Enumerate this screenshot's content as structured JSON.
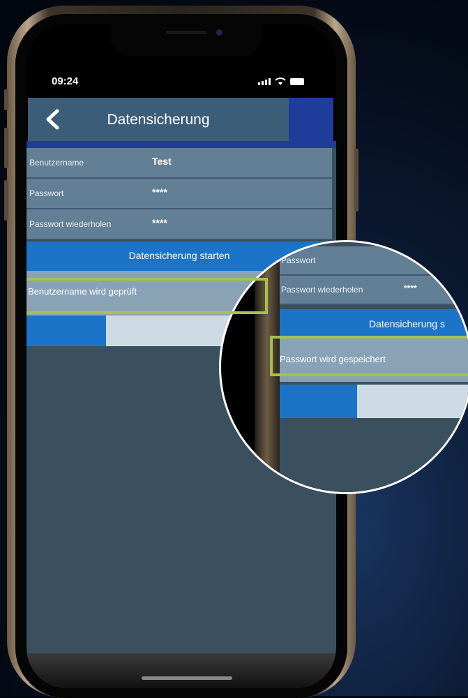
{
  "status_bar": {
    "time": "09:24"
  },
  "header": {
    "title": "Datensicherung"
  },
  "form": {
    "rows": [
      {
        "label": "Benutzername",
        "value": "Test"
      },
      {
        "label": "Passwort",
        "value": "****"
      },
      {
        "label": "Passwort wiederholen",
        "value": "****"
      }
    ],
    "start_button": "Datensicherung starten",
    "status_text": "Benutzername wird geprüft",
    "progress_fraction": 0.26
  },
  "zoom": {
    "rows": [
      {
        "label": "Passwort",
        "value": ""
      },
      {
        "label": "Passwort wiederholen",
        "value": "****"
      }
    ],
    "start_button": "Datensicherung s",
    "status_text": "Passwort wird gespeichert",
    "progress_fraction": 0.37
  },
  "colors": {
    "accent_blue": "#1b74c7",
    "highlight_green": "#a4c24c",
    "header_bg": "#3c5d78"
  }
}
